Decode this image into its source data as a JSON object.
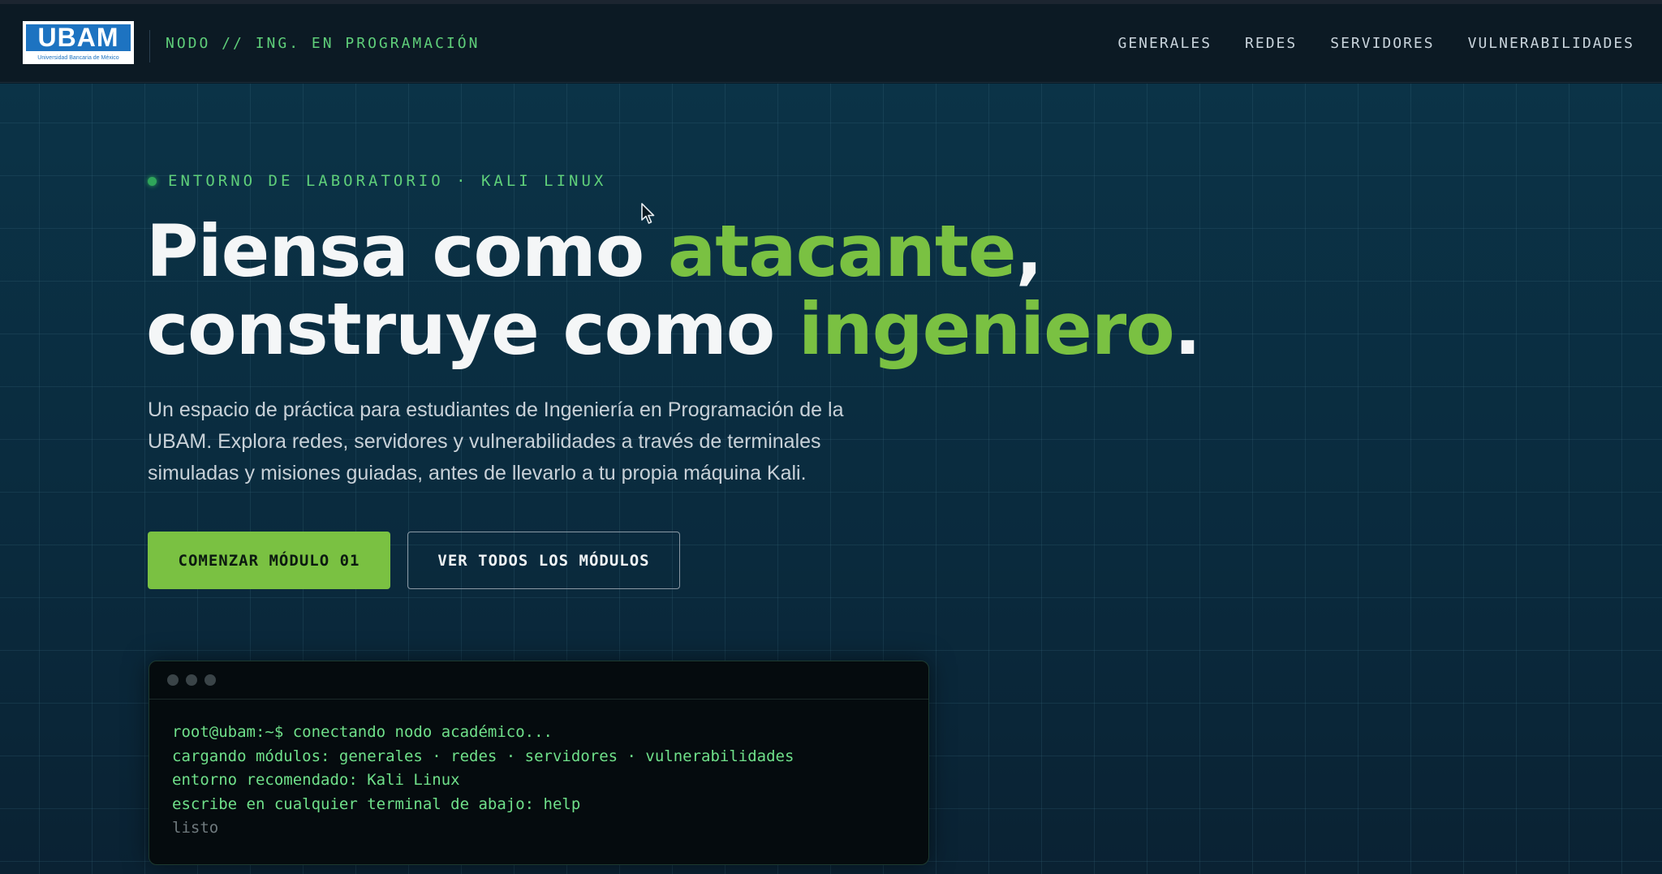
{
  "navbar": {
    "logo_text": "UBAM",
    "logo_subtitle": "Universidad Bancaria de México",
    "tag": "NODO // ING. EN PROGRAMACIÓN",
    "links": [
      "GENERALES",
      "REDES",
      "SERVIDORES",
      "VULNERABILIDADES"
    ]
  },
  "hero": {
    "eyebrow": "ENTORNO DE LABORATORIO · KALI LINUX",
    "headline": {
      "line1_a": "Piensa como ",
      "line1_hl": "atacante",
      "line1_b": ",",
      "line2_a": "construye como ",
      "line2_hl": "ingeniero",
      "line2_b": "."
    },
    "description": "Un espacio de práctica para estudiantes de Ingeniería en Programación de la UBAM. Explora redes, servidores y vulnerabilidades a través de terminales simuladas y misiones guiadas, antes de llevarlo a tu propia máquina Kali.",
    "primary_button": "COMENZAR MÓDULO 01",
    "secondary_button": "VER TODOS LOS MÓDULOS"
  },
  "terminal": {
    "lines": [
      "root@ubam:~$ conectando nodo académico...",
      "cargando módulos: generales · redes · servidores · vulnerabilidades",
      "entorno recomendado: Kali Linux",
      "escribe en cualquier terminal de abajo: help",
      "listo"
    ]
  },
  "colors": {
    "accent_green": "#7ac142",
    "mono_green": "#5fcf7a",
    "background": "#0a1a26",
    "logo_blue": "#1d73c1"
  }
}
